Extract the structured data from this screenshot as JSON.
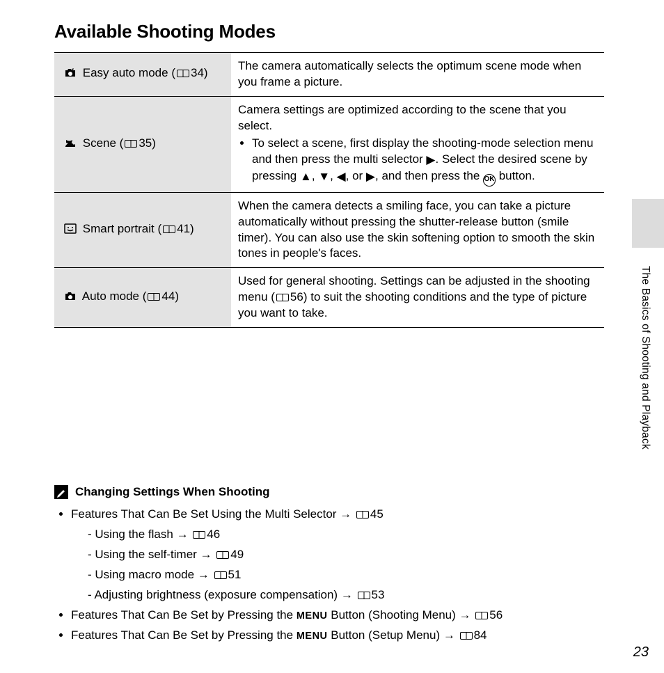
{
  "title": "Available Shooting Modes",
  "side_label": "The Basics of Shooting and Playback",
  "page_number": "23",
  "rows": [
    {
      "name": "Easy auto mode",
      "page_ref": "34",
      "desc_plain": "The camera automatically selects the optimum scene mode when you frame a picture."
    },
    {
      "name": "Scene",
      "page_ref": "35",
      "desc_intro": "Camera settings are optimized according to the scene that you select.",
      "desc_bullet_a": "To select a scene, first display the shooting-mode selection menu and then press the multi selector ",
      "desc_bullet_b": ". Select the desired scene by pressing ",
      "desc_bullet_c": ", and then press the ",
      "desc_bullet_d": " button."
    },
    {
      "name": "Smart portrait",
      "page_ref": "41",
      "desc_plain": "When the camera detects a smiling face, you can take a picture automatically without pressing the shutter-release button (smile timer). You can also use the skin softening option to smooth the skin tones in people's faces."
    },
    {
      "name": "Auto mode",
      "page_ref": "44",
      "desc_a": "Used for general shooting. Settings can be adjusted in the shooting menu (",
      "desc_ref": "56",
      "desc_b": ") to suit the shooting conditions and the type of picture you want to take."
    }
  ],
  "note": {
    "heading": "Changing Settings When Shooting",
    "items": [
      {
        "text": "Features That Can Be Set Using the Multi Selector",
        "ref": "45"
      }
    ],
    "sub": [
      {
        "text": "Using the flash",
        "ref": "46"
      },
      {
        "text": "Using the self-timer",
        "ref": "49"
      },
      {
        "text": "Using macro mode",
        "ref": "51"
      },
      {
        "text": "Adjusting brightness (exposure compensation)",
        "ref": "53"
      }
    ],
    "menu_items": [
      {
        "a": "Features That Can Be Set by Pressing the ",
        "btn": "MENU",
        "b": " Button (Shooting Menu)",
        "ref": "56"
      },
      {
        "a": "Features That Can Be Set by Pressing the ",
        "btn": "MENU",
        "b": " Button (Setup Menu)",
        "ref": "84"
      }
    ]
  },
  "glyphs": {
    "ok": "OK",
    "sep_comma": ", ",
    "sep_or": ", or ",
    "arrow_to": " → "
  }
}
